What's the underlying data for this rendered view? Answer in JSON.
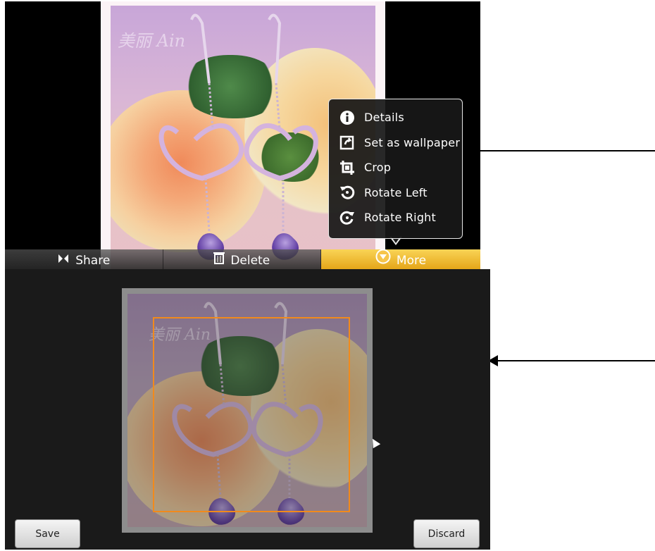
{
  "top_screen": {
    "action_bar": {
      "items": [
        {
          "label": "Share",
          "icon": "share-icon"
        },
        {
          "label": "Delete",
          "icon": "trash-icon"
        },
        {
          "label": "More",
          "icon": "more-icon"
        }
      ]
    },
    "popup_menu": {
      "items": [
        {
          "label": "Details",
          "icon": "info-icon"
        },
        {
          "label": "Set as wallpaper",
          "icon": "wallpaper-icon"
        },
        {
          "label": "Crop",
          "icon": "crop-icon"
        },
        {
          "label": "Rotate Left",
          "icon": "rotate-left-icon"
        },
        {
          "label": "Rotate Right",
          "icon": "rotate-right-icon"
        }
      ]
    },
    "photo": {
      "watermark": "美丽  Ain"
    }
  },
  "bottom_screen": {
    "buttons": {
      "save_label": "Save",
      "discard_label": "Discard"
    },
    "crop_color": "#f18a1c"
  },
  "colors": {
    "more_highlight": "#f2bd33",
    "menu_bg": "#181818",
    "screen_bg": "#1a1a1a"
  }
}
